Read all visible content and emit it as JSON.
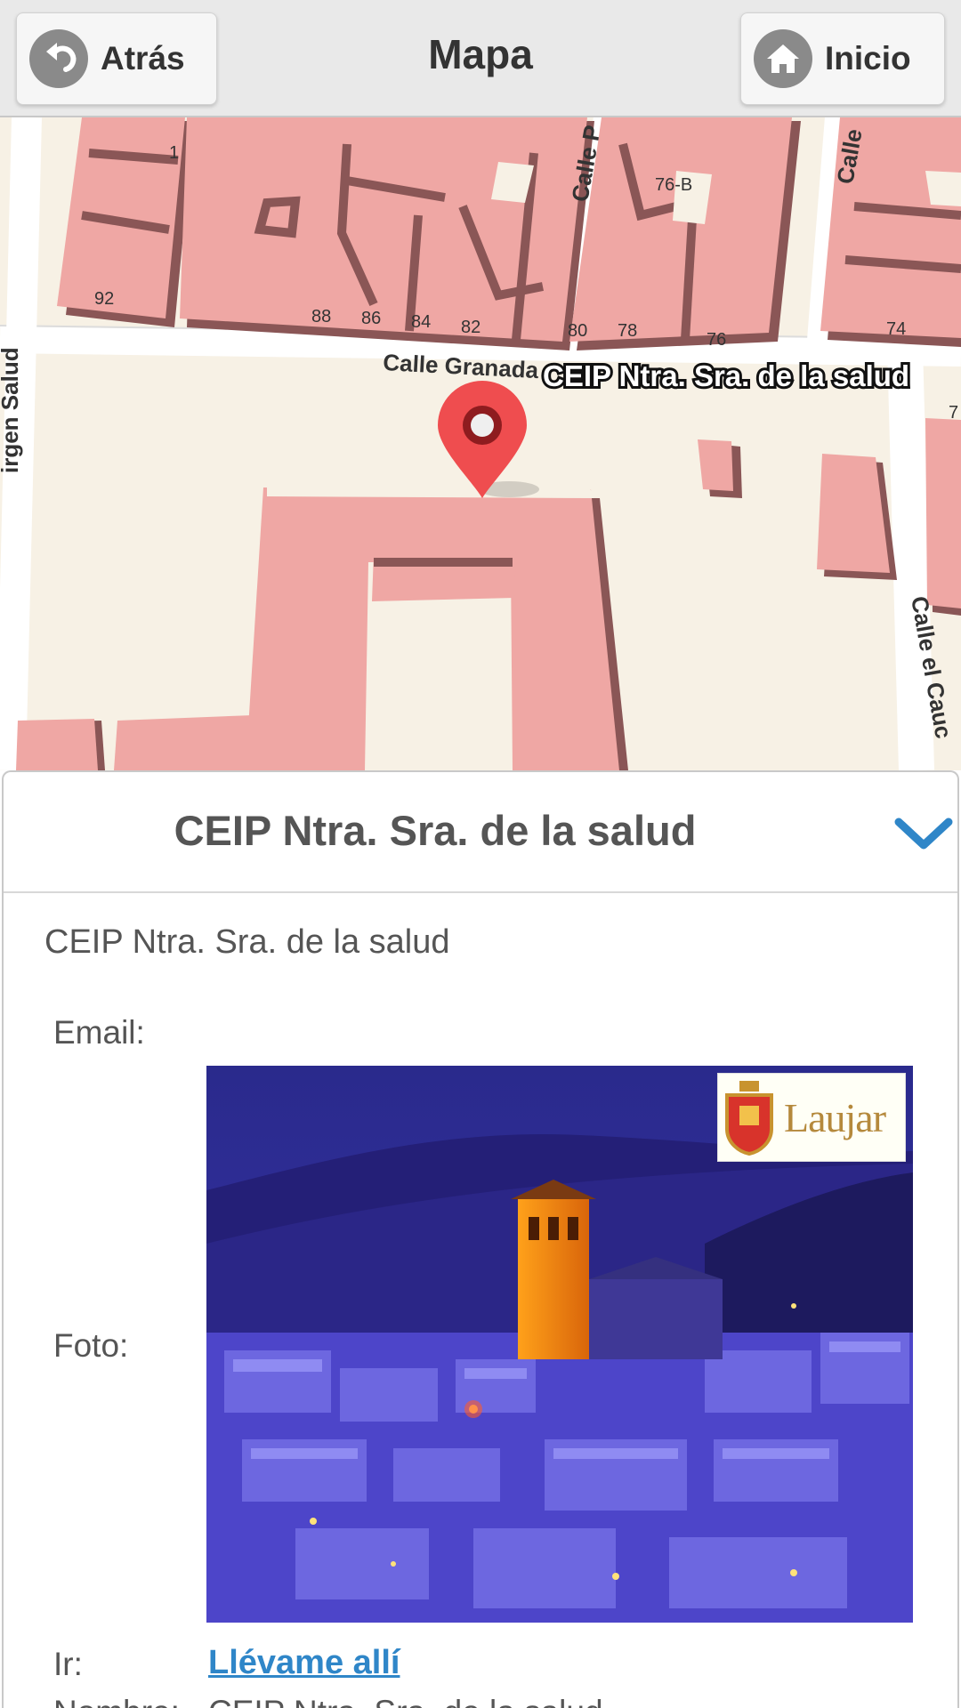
{
  "header": {
    "back_label": "Atrás",
    "title": "Mapa",
    "home_label": "Inicio"
  },
  "map": {
    "marker_label": "CEIP Ntra. Sra. de la salud",
    "streets": [
      "Calle Granada",
      "Calle P",
      "Calle",
      "Calle el Cauc",
      "irgen Salud"
    ],
    "house_numbers": [
      "1",
      "92",
      "88",
      "86",
      "84",
      "82",
      "80",
      "78",
      "76",
      "76-B",
      "74",
      "7"
    ]
  },
  "panel": {
    "title": "CEIP Ntra. Sra. de la salud",
    "description": "CEIP Ntra. Sra. de la salud",
    "email_label": "Email:",
    "photo_label": "Foto:",
    "photo_logo_text": "Laujar",
    "go_label": "Ir:",
    "go_link": "Llévame allí",
    "next_label": "Nombre:",
    "next_value": "CEIP Ntra. Sra. de la salud"
  },
  "colors": {
    "building": "#efa7a4",
    "building_shadow": "#8a5656",
    "ground": "#f7f1e5",
    "marker": "#ef4d4f",
    "link": "#2f86c8",
    "chevron": "#2f86c8"
  }
}
